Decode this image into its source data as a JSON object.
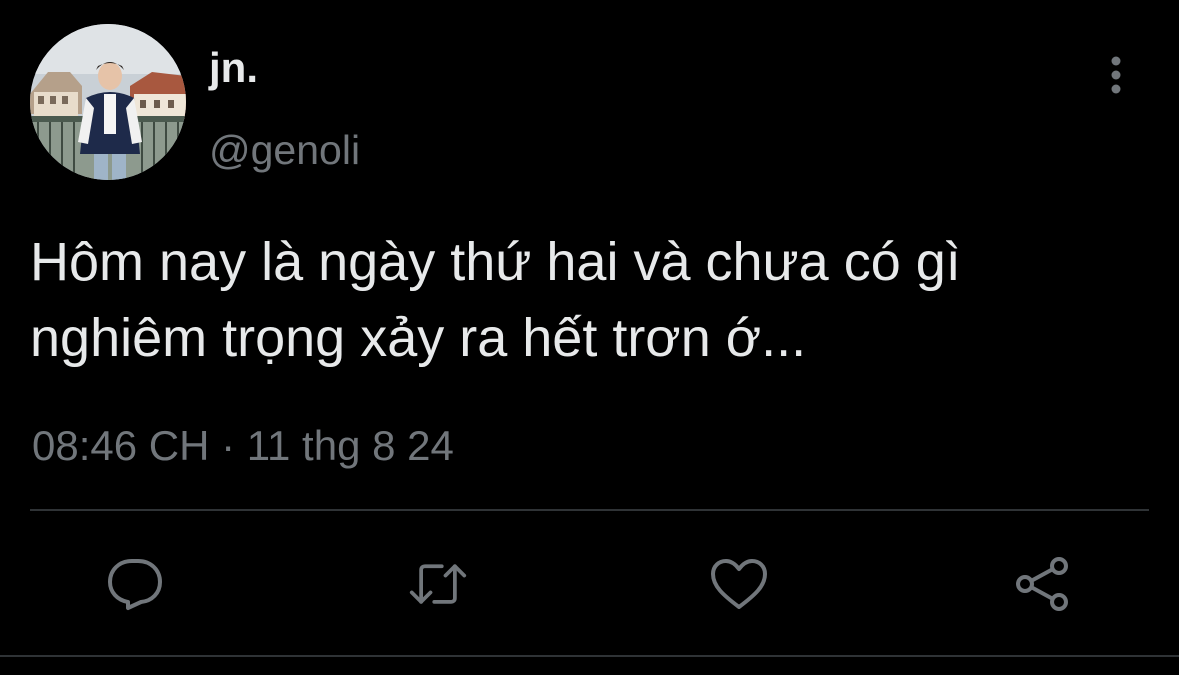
{
  "author": {
    "display_name": "jn.",
    "handle": "@genoli"
  },
  "tweet": {
    "text": "Hôm nay là ngày thứ hai và chưa có gì nghiêm trọng xảy ra hết trơn ớ...",
    "time": "08:46 CH",
    "separator": "·",
    "date": "11 thg 8 24"
  },
  "actions": {
    "reply_icon": "reply-icon",
    "retweet_icon": "retweet-icon",
    "like_icon": "heart-icon",
    "share_icon": "share-icon",
    "more_icon": "more-vertical-icon"
  },
  "colors": {
    "background": "#000000",
    "text_primary": "#e7e9ea",
    "text_secondary": "#71767b",
    "divider": "#2f3336"
  }
}
